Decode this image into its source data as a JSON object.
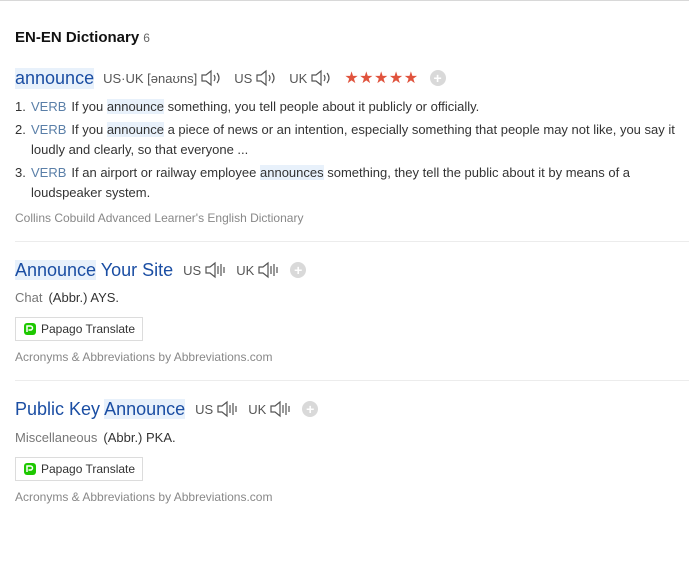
{
  "header": {
    "title": "EN-EN Dictionary",
    "count": "6"
  },
  "entry1": {
    "headword": "announce",
    "pron_region": "US·UK",
    "pron_ipa": "[ənaʊns]",
    "us_label": "US",
    "uk_label": "UK",
    "stars": "★★★★★",
    "rating": 5,
    "plus": "+",
    "defs": [
      {
        "num": "1.",
        "pos": "VERB",
        "pre": "If you ",
        "word": "announce",
        "post": " something, you tell people about it publicly or officially."
      },
      {
        "num": "2.",
        "pos": "VERB",
        "pre": "If you ",
        "word": "announce",
        "post": " a piece of news or an intention, especially something that people may not like, you say it loudly and clearly, so that everyone ..."
      },
      {
        "num": "3.",
        "pos": "VERB",
        "pre": "If an airport or railway employee ",
        "word": "announces",
        "post": " something, they tell the public about it by means of a loudspeaker system."
      }
    ],
    "source": "Collins Cobuild Advanced Learner's English Dictionary"
  },
  "entry2": {
    "headword_hl": "Announce",
    "headword_rest": " Your Site",
    "us_label": "US",
    "uk_label": "UK",
    "plus": "+",
    "category": "Chat",
    "abbr": "(Abbr.) AYS.",
    "translate_label": "Papago Translate",
    "source": "Acronyms & Abbreviations by Abbreviations.com"
  },
  "entry3": {
    "headword_pre": "Public Key ",
    "headword_hl": "Announce",
    "us_label": "US",
    "uk_label": "UK",
    "plus": "+",
    "category": "Miscellaneous",
    "abbr": "(Abbr.) PKA.",
    "translate_label": "Papago Translate",
    "source": "Acronyms & Abbreviations by Abbreviations.com"
  },
  "icons": {
    "speaker": "speaker-icon",
    "speaker_bars": "speaker-bars-icon",
    "papago": "papago-logo-icon",
    "add": "plus-circle-icon"
  },
  "colors": {
    "link": "#1b4ea3",
    "highlight": "#e8f1fb",
    "stars": "#e0533d",
    "pos": "#5a7fa8"
  }
}
